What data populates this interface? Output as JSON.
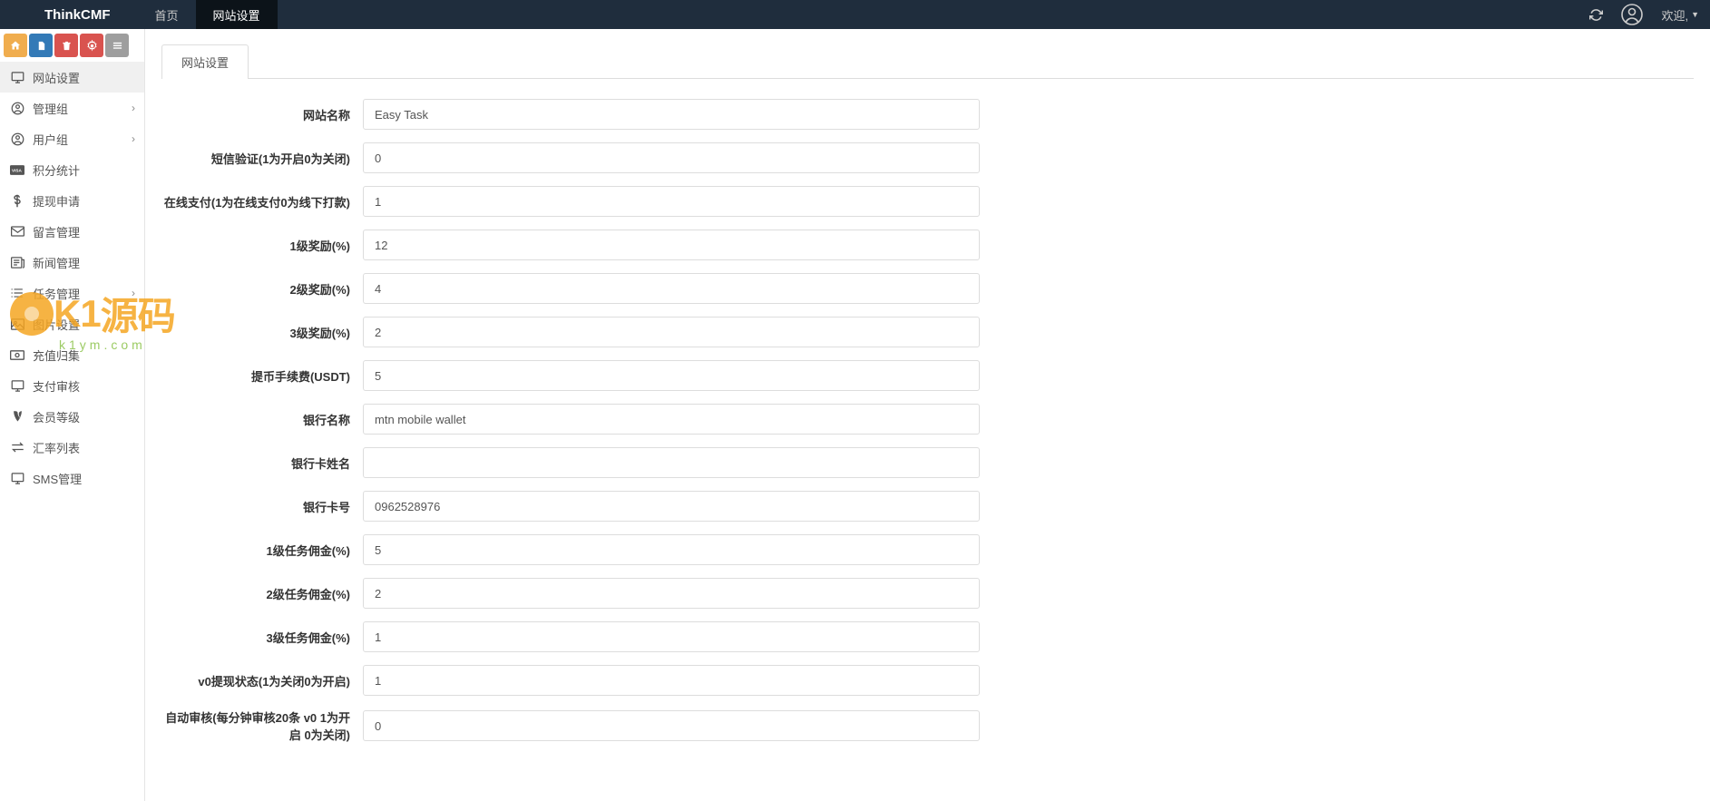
{
  "header": {
    "brand": "ThinkCMF",
    "nav": [
      {
        "label": "首页"
      },
      {
        "label": "网站设置"
      }
    ],
    "welcome": "欢迎,"
  },
  "sidebar": {
    "items": [
      {
        "label": "网站设置",
        "icon": "monitor-icon"
      },
      {
        "label": "管理组",
        "icon": "user-circle-icon",
        "expandable": true
      },
      {
        "label": "用户组",
        "icon": "user-circle-icon",
        "expandable": true
      },
      {
        "label": "积分统计",
        "icon": "visa-icon"
      },
      {
        "label": "提现申请",
        "icon": "dollar-icon"
      },
      {
        "label": "留言管理",
        "icon": "mail-icon"
      },
      {
        "label": "新闻管理",
        "icon": "news-icon"
      },
      {
        "label": "任务管理",
        "icon": "list-icon",
        "expandable": true
      },
      {
        "label": "图片设置",
        "icon": "image-icon"
      },
      {
        "label": "充值归集",
        "icon": "cash-icon"
      },
      {
        "label": "支付审核",
        "icon": "monitor-icon"
      },
      {
        "label": "会员等级",
        "icon": "vine-icon"
      },
      {
        "label": "汇率列表",
        "icon": "exchange-icon"
      },
      {
        "label": "SMS管理",
        "icon": "monitor-icon"
      }
    ]
  },
  "content": {
    "tab": "网站设置",
    "form": [
      {
        "label": "网站名称",
        "value": "Easy Task"
      },
      {
        "label": "短信验证(1为开启0为关闭)",
        "value": "0"
      },
      {
        "label": "在线支付(1为在线支付0为线下打款)",
        "value": "1"
      },
      {
        "label": "1级奖励(%)",
        "value": "12"
      },
      {
        "label": "2级奖励(%)",
        "value": "4"
      },
      {
        "label": "3级奖励(%)",
        "value": "2"
      },
      {
        "label": "提币手续费(USDT)",
        "value": "5"
      },
      {
        "label": "银行名称",
        "value": "mtn mobile wallet"
      },
      {
        "label": "银行卡姓名",
        "value": ""
      },
      {
        "label": "银行卡号",
        "value": "0962528976"
      },
      {
        "label": "1级任务佣金(%)",
        "value": "5"
      },
      {
        "label": "2级任务佣金(%)",
        "value": "2"
      },
      {
        "label": "3级任务佣金(%)",
        "value": "1"
      },
      {
        "label": "v0提现状态(1为关闭0为开启)",
        "value": "1"
      },
      {
        "label": "自动审核(每分钟审核20条 v0 1为开启 0为关闭)",
        "value": "0"
      }
    ]
  },
  "watermark": {
    "text1": "K1",
    "text2": "源码",
    "sub": "k1ym.com"
  }
}
